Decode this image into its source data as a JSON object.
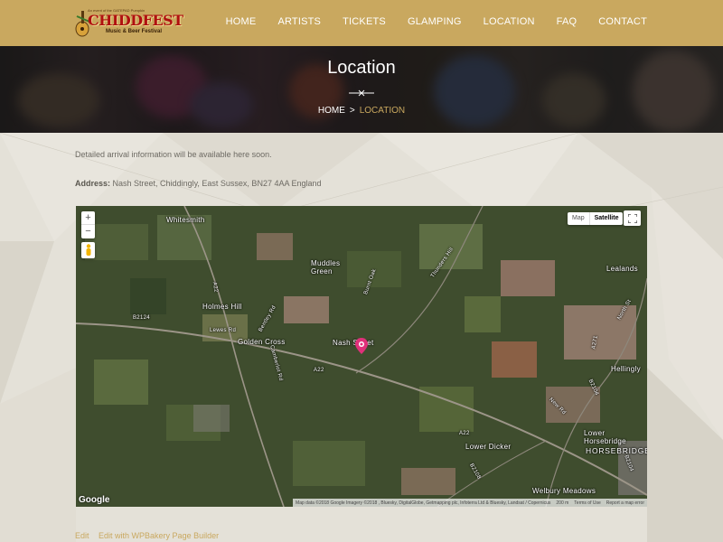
{
  "logo": {
    "tagline": "An event of the GATEPAD Pumpkin",
    "name": "CHIDDFEST",
    "subtitle": "Music & Beer Festival"
  },
  "nav": {
    "items": [
      "HOME",
      "ARTISTS",
      "TICKETS",
      "GLAMPING",
      "LOCATION",
      "FAQ",
      "CONTACT"
    ]
  },
  "hero": {
    "title": "Location",
    "breadcrumb_home": "HOME",
    "breadcrumb_separator": ">",
    "breadcrumb_current": "LOCATION"
  },
  "content": {
    "arrival_text": "Detailed arrival information will be available here soon.",
    "address_label": "Address:",
    "address_value": "Nash Street, Chiddingly, East Sussex, BN27 4AA England"
  },
  "map": {
    "zoom_in": "+",
    "zoom_out": "−",
    "type_map": "Map",
    "type_satellite": "Satellite",
    "selected_type": "Satellite",
    "google_logo": "Google",
    "attribution": "Map data ©2018 Google Imagery ©2018 , Bluesky, DigitalGlobe, Getmapping plc, Infoterra Ltd & Bluesky, Landsat / Copernicus",
    "scale": "200 m",
    "terms": "Terms of Use",
    "report": "Report a map error",
    "labels": {
      "whitesmith": "Whitesmith",
      "muddles_green": "Muddles\nGreen",
      "holmes_hill": "Holmes Hill",
      "golden_cross": "Golden Cross",
      "nash_street": "Nash Street",
      "lealands": "Lealands",
      "hellingly": "Hellingly",
      "lower_horsebridge": "Lower\nHorsebridge",
      "horsebridge": "HORSEBRIDGE",
      "lower_dicker": "Lower Dicker",
      "welbury_meadows": "Welbury Meadows",
      "a22_1": "A22",
      "a22_2": "A22",
      "b2124": "B2124",
      "lewes_rd": "Lewes Rd",
      "bentley_rd": "Bentley Rd",
      "thunders_hill": "Thunders Hill",
      "burnt_oak": "Burnt Oak",
      "a271": "A271",
      "b2104": "B2104",
      "north_st": "North St",
      "camberlot_rd": "Camberlot Rd",
      "new_rd": "New Rd",
      "a22_3": "A22",
      "b2108": "B2108",
      "b2104_2": "B2104"
    }
  },
  "edit_links": [
    "Edit",
    "Edit with WPBakery Page Builder"
  ],
  "colors": {
    "header": "#c9a85f",
    "accent": "#c9a85f",
    "page_bg": "#e4e1d8",
    "text": "#6d6a63"
  }
}
